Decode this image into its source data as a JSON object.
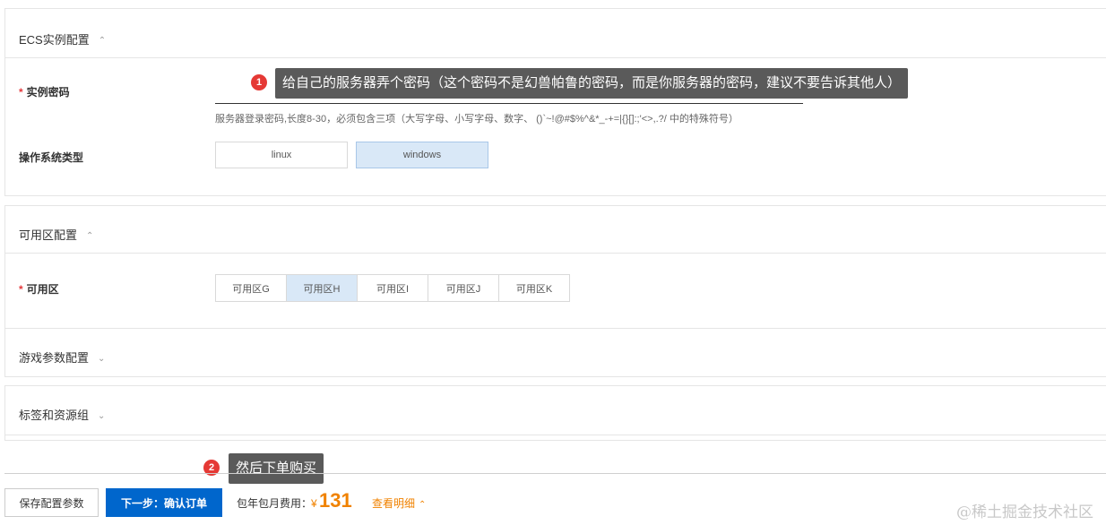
{
  "ecs_section": {
    "title": "ECS实例配置",
    "password_label": "实例密码",
    "password_hint": "服务器登录密码,长度8-30，必须包含三项（大写字母、小写字母、数字、 ()`~!@#$%^&*_-+=|{}[]:;'<>,.?/ 中的特殊符号）",
    "password_value": "",
    "os_label": "操作系统类型",
    "os_options": [
      "linux",
      "windows"
    ],
    "os_selected": "windows"
  },
  "zone_section": {
    "title": "可用区配置",
    "zone_label": "可用区",
    "zones": [
      "可用区G",
      "可用区H",
      "可用区I",
      "可用区J",
      "可用区K"
    ],
    "zone_selected": "可用区H"
  },
  "game_section": {
    "title": "游戏参数配置"
  },
  "tags_section": {
    "title": "标签和资源组"
  },
  "annotations": {
    "tip1_number": "1",
    "tip1_text": "给自己的服务器弄个密码（这个密码不是幻兽帕鲁的密码，而是你服务器的密码，建议不要告诉其他人）",
    "tip2_number": "2",
    "tip2_text": "然后下单购买"
  },
  "footer": {
    "save_label": "保存配置参数",
    "next_label": "下一步：确认订单",
    "fee_label": "包年包月费用：",
    "fee_currency": "¥",
    "fee_amount": "131",
    "detail_label": "查看明细"
  },
  "watermark": "@稀土掘金技术社区",
  "icons": {
    "chevron_up": "chevron-up-icon",
    "chevron_down": "chevron-down-icon",
    "required_star": "asterisk-icon"
  },
  "colors": {
    "primary": "#0066cc",
    "selected_bg": "#d9e8f7",
    "price": "#f08200",
    "badge": "#e53935",
    "tooltip_bg": "#5a5a5a",
    "required": "#e4393c"
  }
}
